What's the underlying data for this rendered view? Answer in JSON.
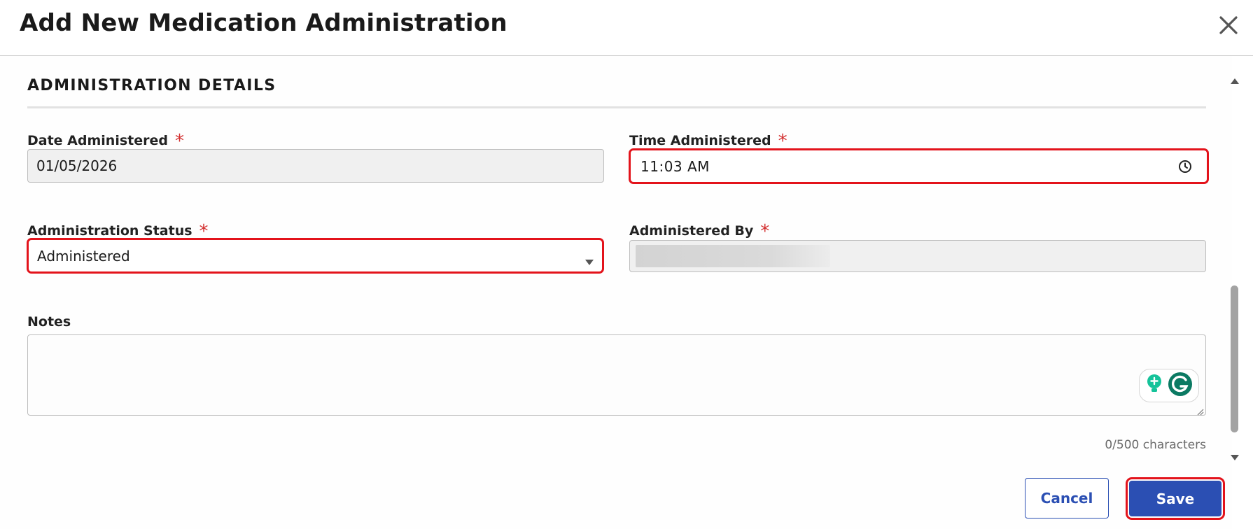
{
  "dialog": {
    "title": "Add New Medication Administration"
  },
  "section": {
    "title": "ADMINISTRATION DETAILS"
  },
  "fields": {
    "date_administered": {
      "label": "Date Administered",
      "required_mark": "*",
      "value": "01/05/2026"
    },
    "time_administered": {
      "label": "Time Administered",
      "required_mark": "*",
      "value": "11:03 AM"
    },
    "administration_status": {
      "label": "Administration Status",
      "required_mark": "*",
      "value": "Administered"
    },
    "administered_by": {
      "label": "Administered By",
      "required_mark": "*",
      "value": ""
    },
    "notes": {
      "label": "Notes",
      "value": "",
      "counter": "0/500 characters"
    }
  },
  "actions": {
    "cancel_label": "Cancel",
    "save_label": "Save"
  },
  "colors": {
    "primary": "#2b4fb3",
    "required": "#d32f2f",
    "highlight": "#e3131b"
  },
  "icons": [
    "close-icon",
    "clock-icon",
    "chevron-down-icon",
    "grammarly-icon",
    "lightbulb-icon"
  ]
}
